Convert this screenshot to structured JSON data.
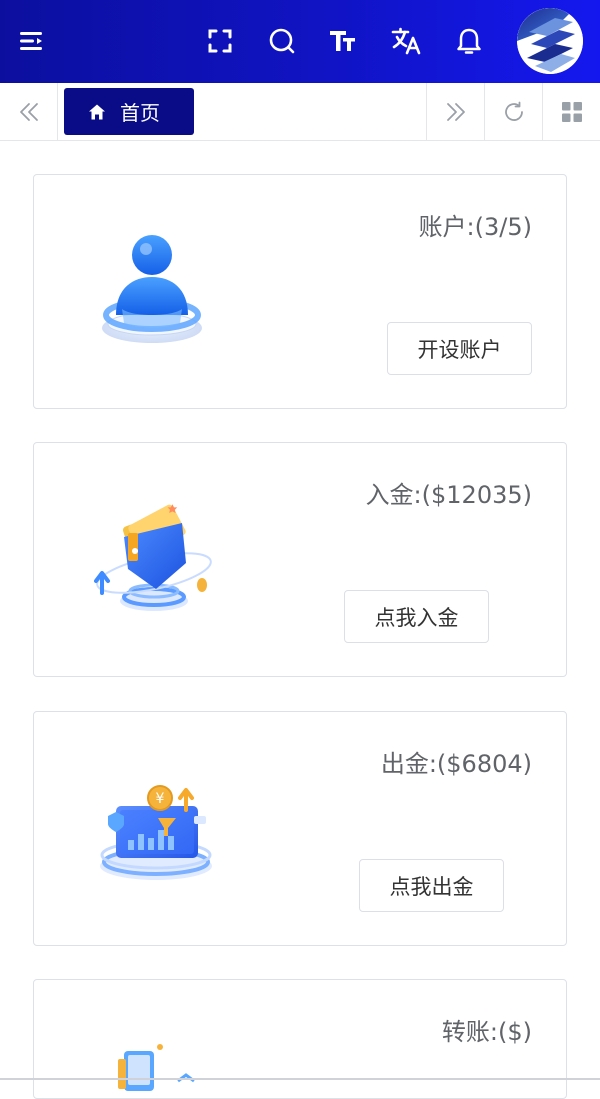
{
  "topbar": {
    "icons": [
      "menu-icon",
      "fullscreen-icon",
      "search-icon",
      "font-size-icon",
      "translate-icon",
      "bell-icon"
    ],
    "colors": {
      "from": "#0c0f9e",
      "to": "#1518ee"
    }
  },
  "tabbar": {
    "home_label": "首页",
    "icons": [
      "double-left-icon",
      "home-icon",
      "double-right-icon",
      "refresh-icon",
      "grid-icon"
    ]
  },
  "cards": [
    {
      "label": "账户:(3/5)",
      "button": "开设账户",
      "icon": "account-illustration"
    },
    {
      "label": "入金:($12035)",
      "button": "点我入金",
      "icon": "wallet-deposit-illustration"
    },
    {
      "label": "出金:($6804)",
      "button": "点我出金",
      "icon": "card-withdraw-illustration"
    },
    {
      "label": "转账:($)",
      "icon": "transfer-illustration"
    }
  ]
}
